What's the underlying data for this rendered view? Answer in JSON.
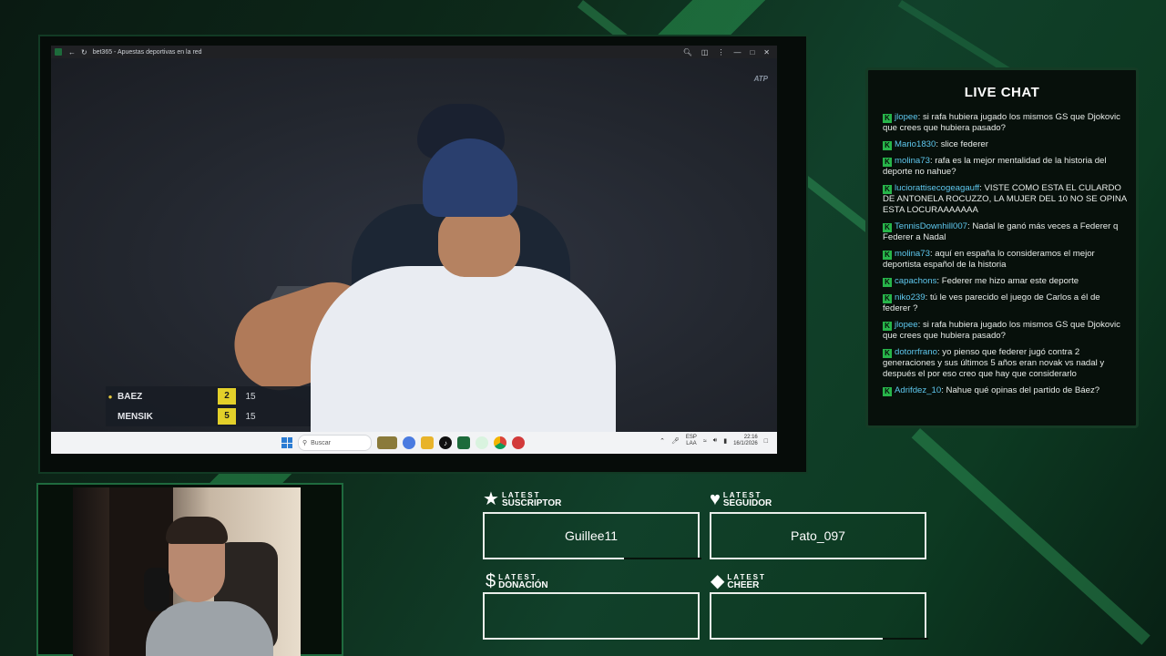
{
  "browser": {
    "title": "bet365 - Apuestas deportivas en la red"
  },
  "video": {
    "watermark": "ATP",
    "scoreboard": [
      {
        "name": "BAEZ",
        "sets": "2",
        "points": "15",
        "serving": true
      },
      {
        "name": "MENSIK",
        "sets": "5",
        "points": "15",
        "serving": false
      }
    ]
  },
  "taskbar": {
    "search_placeholder": "Buscar",
    "lang_top": "ESP",
    "lang_bottom": "LAA",
    "time": "22:16",
    "date": "16/1/2026"
  },
  "chat": {
    "title": "LIVE CHAT",
    "badge": "K",
    "messages": [
      {
        "user": "jlopee",
        "text": "si rafa hubiera jugado los mismos GS que Djokovic que crees que hubiera pasado?"
      },
      {
        "user": "Mario1830",
        "text": "slice federer"
      },
      {
        "user": "molina73",
        "text": "rafa es la mejor mentalidad de la historia del deporte no nahue?"
      },
      {
        "user": "luciorattisecogeagauff",
        "text": "VISTE COMO ESTA EL CULARDO DE ANTONELA ROCUZZO, LA MUJER DEL 10 NO SE OPINA ESTA LOCURAAAAAAA"
      },
      {
        "user": "TennisDownhill007",
        "text": "Nadal le ganó más veces a Federer q Federer a Nadal"
      },
      {
        "user": "molina73",
        "text": "aquí en españa lo consideramos el mejor deportista español de la historia"
      },
      {
        "user": "capachons",
        "text": "Federer me hizo amar este deporte"
      },
      {
        "user": "niko239",
        "text": "tú le ves parecido el juego de Carlos a él de federer ?"
      },
      {
        "user": "jlopee",
        "text": "si rafa hubiera jugado los mismos GS que Djokovic que crees que hubiera pasado?"
      },
      {
        "user": "dotorrfrano",
        "text": "yo pienso que federer jugó contra 2 generaciones y sus últimos 5 años eran novak vs nadal y después el por eso creo que hay que considerarlo"
      },
      {
        "user": "Adrifdez_10",
        "text": "Nahue qué opinas del partido de Báez?"
      }
    ]
  },
  "alerts": {
    "subscriber": {
      "label_small": "LATEST",
      "label_big": "SUSCRIPTOR",
      "value": "Guillee11"
    },
    "follower": {
      "label_small": "LATEST",
      "label_big": "SEGUIDOR",
      "value": "Pato_097"
    },
    "donation": {
      "label_small": "LATEST",
      "label_big": "DONACIÓN",
      "value": ""
    },
    "cheer": {
      "label_small": "LATEST",
      "label_big": "CHEER",
      "value": ""
    }
  },
  "colors": {
    "accent_green": "#27b54a",
    "username_blue": "#5fc8ef",
    "score_yellow": "#e3d02a"
  }
}
